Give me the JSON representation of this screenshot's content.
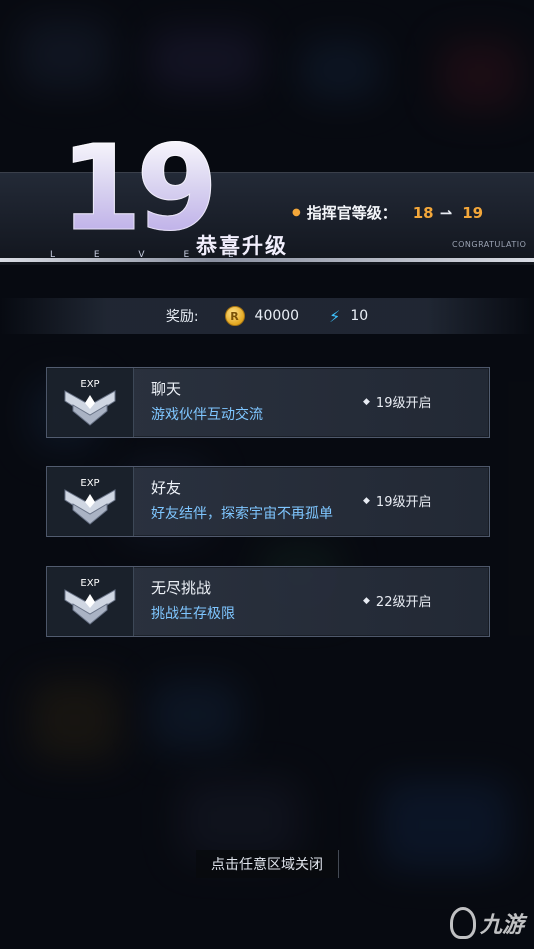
{
  "header": {
    "level_number": "19",
    "level_sub": "L E V E L",
    "title": "恭喜升级",
    "commander_label": "指挥官等级：",
    "level_from": "18",
    "level_arrow": "⇀",
    "level_to": "19",
    "congrats_text": "CONGRATULATIO"
  },
  "reward": {
    "label": "奖励:",
    "coin_icon": "coin-icon",
    "coin_symbol": "R",
    "coin_amount": "40000",
    "energy_icon": "lightning-icon",
    "energy_amount": "10"
  },
  "features": [
    {
      "icon_text": "EXP",
      "name": "聊天",
      "desc": "游戏伙伴互动交流",
      "requirement": "19级开启"
    },
    {
      "icon_text": "EXP",
      "name": "好友",
      "desc": "好友结伴，探索宇宙不再孤单",
      "requirement": "19级开启"
    },
    {
      "icon_text": "EXP",
      "name": "无尽挑战",
      "desc": "挑战生存极限",
      "requirement": "22级开启"
    }
  ],
  "close_hint": "点击任意区域关闭",
  "watermark": "九游",
  "colors": {
    "accent_orange": "#f3a73a",
    "desc_blue": "#7fc6ff",
    "energy_blue": "#3ec3ff"
  }
}
